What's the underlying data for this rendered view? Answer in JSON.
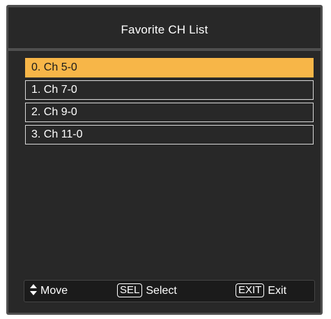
{
  "dialog": {
    "title": "Favorite CH List"
  },
  "channels": [
    {
      "label": "0. Ch 5-0",
      "selected": true
    },
    {
      "label": "1. Ch 7-0",
      "selected": false
    },
    {
      "label": "2. Ch 9-0",
      "selected": false
    },
    {
      "label": "3. Ch 11-0",
      "selected": false
    }
  ],
  "help_bar": {
    "move": {
      "icon": "up-down-arrows-icon",
      "label": "Move"
    },
    "select": {
      "key": "SEL",
      "label": "Select"
    },
    "exit": {
      "key": "EXIT",
      "label": "Exit"
    }
  },
  "colors": {
    "highlight": "#f7b648",
    "panel_background": "#282828",
    "frame": "#4f4f4f"
  }
}
